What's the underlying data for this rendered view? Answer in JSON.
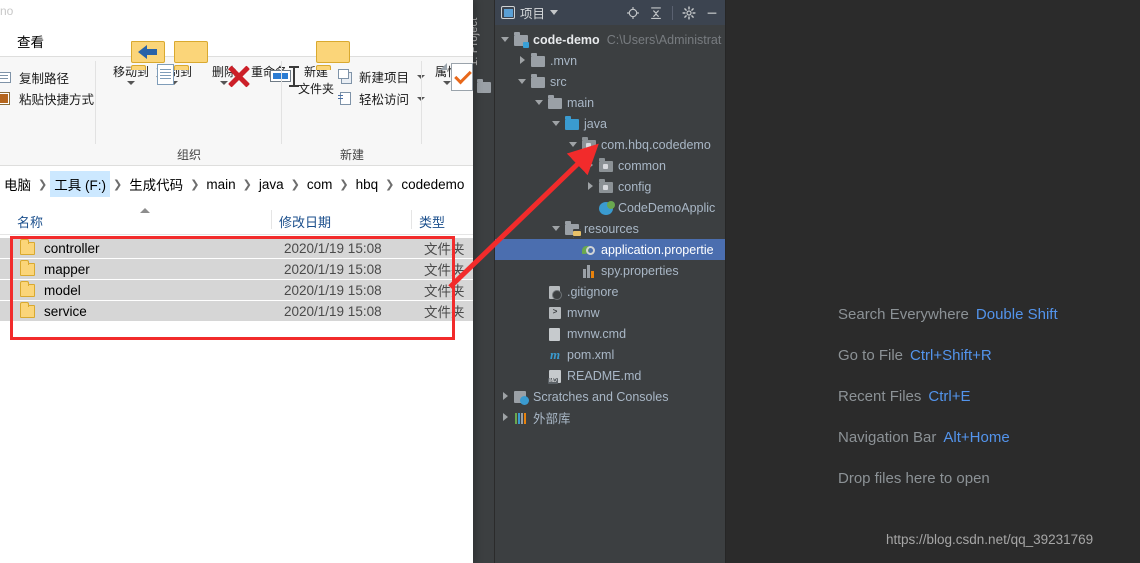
{
  "ide": {
    "tool_strip_label": "1: Project",
    "panel": {
      "title": "项目",
      "icons": [
        "project-view-icon",
        "chevron-down-icon",
        "locate-target-icon",
        "collapse-all-icon",
        "settings-gear-icon",
        "hide-minimize-icon"
      ]
    },
    "tree": [
      {
        "label": "code-demo",
        "sub": "C:\\Users\\Administrat",
        "icon": "module-folder-icon",
        "depth": 0,
        "twisty": "open",
        "bold": true
      },
      {
        "label": ".mvn",
        "sub": "",
        "icon": "folder-icon",
        "depth": 1,
        "twisty": "closed",
        "bold": false
      },
      {
        "label": "src",
        "sub": "",
        "icon": "folder-icon",
        "depth": 1,
        "twisty": "open",
        "bold": false
      },
      {
        "label": "main",
        "sub": "",
        "icon": "folder-icon",
        "depth": 2,
        "twisty": "open",
        "bold": false
      },
      {
        "label": "java",
        "sub": "",
        "icon": "source-root-folder-icon",
        "depth": 3,
        "twisty": "open",
        "bold": false
      },
      {
        "label": "com.hbq.codedemo",
        "sub": "",
        "icon": "package-icon",
        "depth": 4,
        "twisty": "open",
        "bold": false
      },
      {
        "label": "common",
        "sub": "",
        "icon": "package-icon",
        "depth": 5,
        "twisty": "closed",
        "bold": false
      },
      {
        "label": "config",
        "sub": "",
        "icon": "package-icon",
        "depth": 5,
        "twisty": "closed",
        "bold": false
      },
      {
        "label": "CodeDemoApplic",
        "sub": "",
        "icon": "spring-class-icon",
        "depth": 5,
        "twisty": "none",
        "bold": false
      },
      {
        "label": "resources",
        "sub": "",
        "icon": "resources-folder-icon",
        "depth": 3,
        "twisty": "open",
        "bold": false
      },
      {
        "label": "application.propertie",
        "sub": "",
        "icon": "spring-properties-icon",
        "depth": 4,
        "twisty": "none",
        "bold": false,
        "selected": true
      },
      {
        "label": "spy.properties",
        "sub": "",
        "icon": "properties-file-icon",
        "depth": 4,
        "twisty": "none",
        "bold": false
      },
      {
        "label": ".gitignore",
        "sub": "",
        "icon": "gitignore-file-icon",
        "depth": 2,
        "twisty": "none",
        "bold": false
      },
      {
        "label": "mvnw",
        "sub": "",
        "icon": "shell-script-icon",
        "depth": 2,
        "twisty": "none",
        "bold": false
      },
      {
        "label": "mvnw.cmd",
        "sub": "",
        "icon": "cmd-script-icon",
        "depth": 2,
        "twisty": "none",
        "bold": false
      },
      {
        "label": "pom.xml",
        "sub": "",
        "icon": "maven-pom-icon",
        "depth": 2,
        "twisty": "none",
        "bold": false
      },
      {
        "label": "README.md",
        "sub": "",
        "icon": "markdown-file-icon",
        "depth": 2,
        "twisty": "none",
        "bold": false
      },
      {
        "label": "Scratches and Consoles",
        "sub": "",
        "icon": "scratches-icon",
        "depth": 0,
        "twisty": "closed",
        "bold": false
      },
      {
        "label": "外部库",
        "sub": "",
        "icon": "external-libraries-icon",
        "depth": 0,
        "twisty": "closed",
        "bold": false
      }
    ],
    "editor_hints": [
      {
        "action": "Search Everywhere",
        "shortcut": "Double Shift"
      },
      {
        "action": "Go to File",
        "shortcut": "Ctrl+Shift+R"
      },
      {
        "action": "Recent Files",
        "shortcut": "Ctrl+E"
      },
      {
        "action": "Navigation Bar",
        "shortcut": "Alt+Home"
      },
      {
        "action": "Drop files here to open",
        "shortcut": ""
      }
    ],
    "watermark": "https://blog.csdn.net/qq_39231769",
    "colors": {
      "panel_bg": "#3c3f41",
      "editor_bg": "#2b2b2b",
      "selection": "#4b6eaf",
      "shortcut": "#5394ec"
    }
  },
  "explorer": {
    "tab_text": "no",
    "ribbon_tab": "查看",
    "clipboard_small": [
      {
        "label": "复制路径",
        "icon": "copy-path-icon"
      },
      {
        "label": "粘贴快捷方式",
        "icon": "paste-shortcut-icon"
      }
    ],
    "organize_group": {
      "label": "组织",
      "buttons": [
        {
          "label": "移动到",
          "icon": "move-to-icon",
          "dropdown": true
        },
        {
          "label": "复制到",
          "icon": "copy-to-icon",
          "dropdown": true
        },
        {
          "label": "删除",
          "icon": "delete-icon",
          "dropdown": true
        },
        {
          "label": "重命名",
          "icon": "rename-icon",
          "dropdown": false
        }
      ]
    },
    "new_group": {
      "label": "新建",
      "big_button": {
        "label_line1": "新建",
        "label_line2": "文件夹",
        "icon": "new-folder-icon"
      },
      "small_buttons": [
        {
          "label": "新建项目",
          "icon": "new-item-icon",
          "dropdown": true
        },
        {
          "label": "轻松访问",
          "icon": "easy-access-icon",
          "dropdown": true
        }
      ]
    },
    "open_group": {
      "button": {
        "label": "属性",
        "icon": "properties-icon",
        "dropdown": true
      }
    },
    "breadcrumb": [
      "电脑",
      "工具 (F:)",
      "生成代码",
      "main",
      "java",
      "com",
      "hbq",
      "codedemo"
    ],
    "breadcrumb_active_index": 1,
    "columns": [
      "名称",
      "修改日期",
      "类型"
    ],
    "sort_column_index": 0,
    "rows": [
      {
        "name": "controller",
        "date": "2020/1/19 15:08",
        "type": "文件夹",
        "icon": "folder-icon"
      },
      {
        "name": "mapper",
        "date": "2020/1/19 15:08",
        "type": "文件夹",
        "icon": "folder-icon"
      },
      {
        "name": "model",
        "date": "2020/1/19 15:08",
        "type": "文件夹",
        "icon": "folder-icon"
      },
      {
        "name": "service",
        "date": "2020/1/19 15:08",
        "type": "文件夹",
        "icon": "folder-icon"
      }
    ]
  },
  "annotations": {
    "highlight_color": "#f22b2b",
    "box_label": "selected-folders-highlight",
    "arrow_label": "pointer-arrow-to-package"
  }
}
